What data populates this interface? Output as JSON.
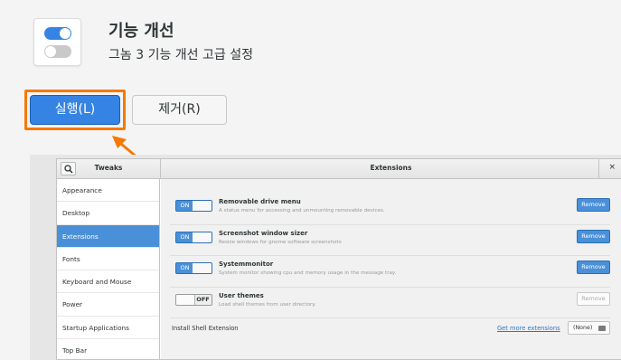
{
  "app": {
    "name": "기능 개선",
    "summary": "그놈 3 기능 개선 고급 설정",
    "launch_label": "실행(L)",
    "remove_label": "제거(R)",
    "accent_color": "#3584e4",
    "highlight_color": "#f57900"
  },
  "screenshot": {
    "sidebar_title": "Tweaks",
    "main_title": "Extensions",
    "close_glyph": "×",
    "sidebar_items": [
      {
        "label": "Appearance"
      },
      {
        "label": "Desktop"
      },
      {
        "label": "Extensions"
      },
      {
        "label": "Fonts"
      },
      {
        "label": "Keyboard and Mouse"
      },
      {
        "label": "Power"
      },
      {
        "label": "Startup Applications"
      },
      {
        "label": "Top Bar"
      }
    ],
    "extensions": [
      {
        "name": "Removable drive menu",
        "description": "A status menu for accessing and unmounting removable devices.",
        "state": "ON",
        "remove_label": "Remove"
      },
      {
        "name": "Screenshot window sizer",
        "description": "Resize windows for gnome software screenshots",
        "state": "ON",
        "remove_label": "Remove"
      },
      {
        "name": "Systemmonitor",
        "description": "System monitor showing cpu and memory usage in the message tray.",
        "state": "ON",
        "remove_label": "Remove"
      },
      {
        "name": "User themes",
        "description": "Load shell themes from user directory.",
        "state": "OFF",
        "remove_label": "Remove"
      }
    ],
    "install_label": "Install Shell Extension",
    "more_link": "Get more extensions",
    "file_chooser_value": "(None)"
  }
}
